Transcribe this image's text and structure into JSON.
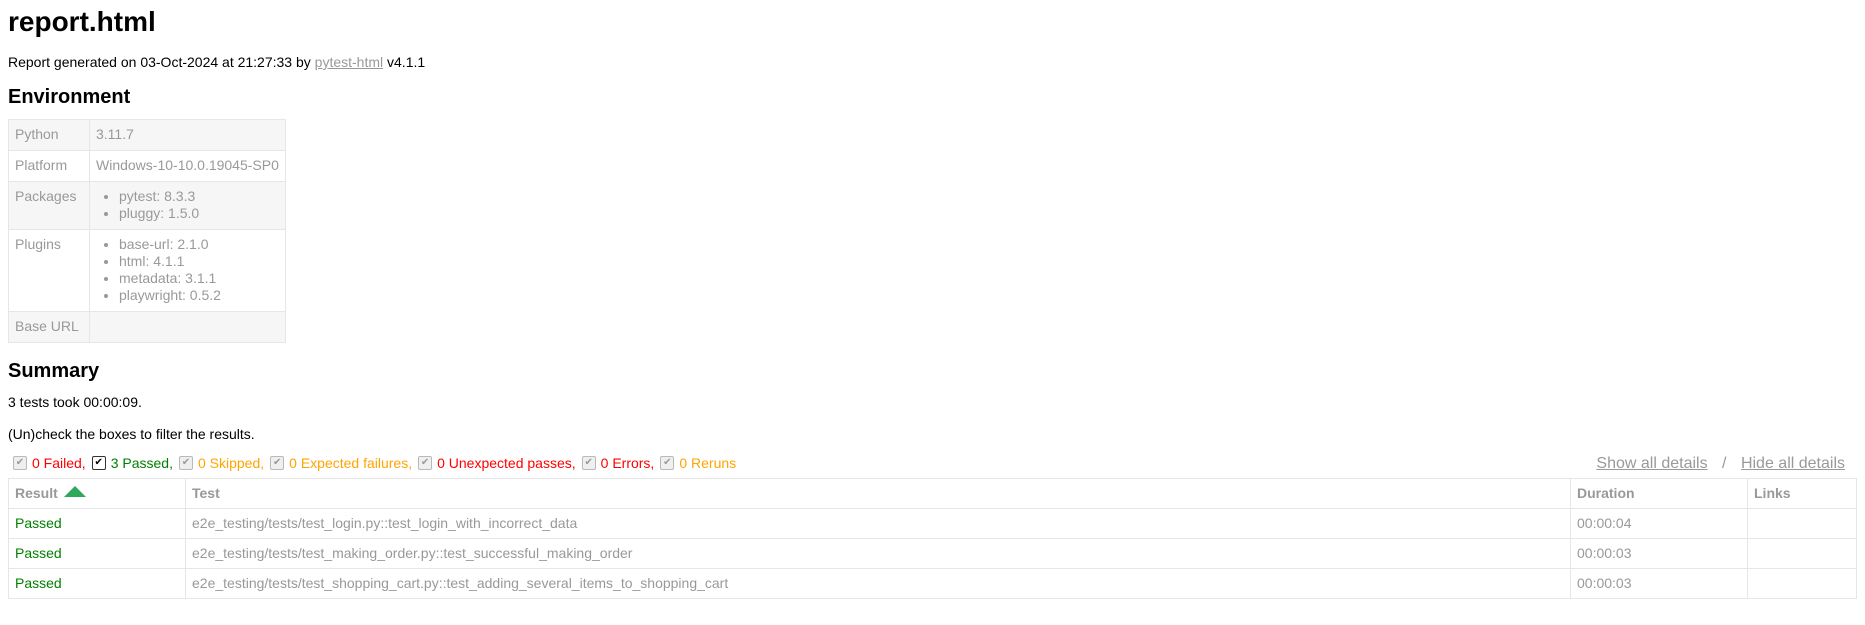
{
  "title": "report.html",
  "generated": {
    "prefix": "Report generated on 03-Oct-2024 at 21:27:33 by",
    "link": "pytest-html",
    "suffix": "v4.1.1"
  },
  "environment": {
    "heading": "Environment",
    "python_label": "Python",
    "python_value": "3.11.7",
    "platform_label": "Platform",
    "platform_value": "Windows-10-10.0.19045-SP0",
    "packages_label": "Packages",
    "packages": [
      "pytest: 8.3.3",
      "pluggy: 1.5.0"
    ],
    "plugins_label": "Plugins",
    "plugins": [
      "base-url: 2.1.0",
      "html: 4.1.1",
      "metadata: 3.1.1",
      "playwright: 0.5.2"
    ],
    "base_url_label": "Base URL",
    "base_url_value": ""
  },
  "summary": {
    "heading": "Summary",
    "duration_text": "3 tests took 00:00:09.",
    "filter_hint": "(Un)check the boxes to filter the results."
  },
  "filters": [
    {
      "label": "0 Failed,",
      "checked": true,
      "active": false,
      "color": "#ff0000"
    },
    {
      "label": "3 Passed,",
      "checked": true,
      "active": true,
      "color": "#008000"
    },
    {
      "label": "0 Skipped,",
      "checked": true,
      "active": false,
      "color": "#ffa500"
    },
    {
      "label": "0 Expected failures,",
      "checked": true,
      "active": false,
      "color": "#ffa500"
    },
    {
      "label": "0 Unexpected passes,",
      "checked": true,
      "active": false,
      "color": "#ff0000"
    },
    {
      "label": "0 Errors,",
      "checked": true,
      "active": false,
      "color": "#ff0000"
    },
    {
      "label": "0 Reruns",
      "checked": true,
      "active": false,
      "color": "#ffa500"
    }
  ],
  "details": {
    "show_all": "Show all details",
    "separator": "/",
    "hide_all": "Hide all details"
  },
  "results": {
    "headers": {
      "result": "Result",
      "test": "Test",
      "duration": "Duration",
      "links": "Links"
    },
    "sort_icon": "sort-ascending-arrow-icon",
    "rows": [
      {
        "result": "Passed",
        "test": "e2e_testing/tests/test_login.py::test_login_with_incorrect_data",
        "duration": "00:00:04",
        "links": ""
      },
      {
        "result": "Passed",
        "test": "e2e_testing/tests/test_making_order.py::test_successful_making_order",
        "duration": "00:00:03",
        "links": ""
      },
      {
        "result": "Passed",
        "test": "e2e_testing/tests/test_shopping_cart.py::test_adding_several_items_to_shopping_cart",
        "duration": "00:00:03",
        "links": ""
      }
    ]
  }
}
